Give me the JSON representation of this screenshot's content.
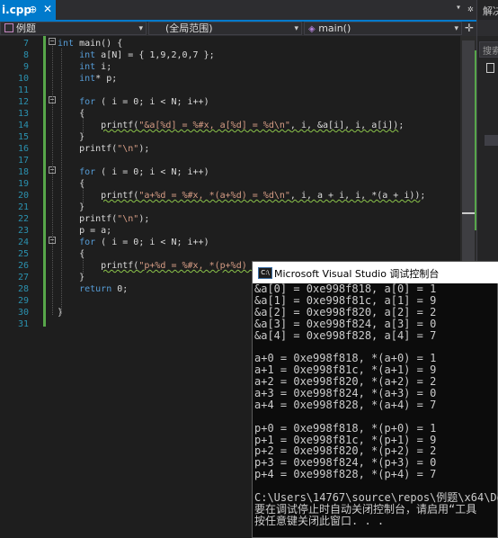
{
  "tab": {
    "filename": "i.cpp",
    "pin": "⊕",
    "close": "✕"
  },
  "toolbar": {
    "dropdown_glyph": "▾",
    "gear_glyph": "✲",
    "split_glyph": "✛"
  },
  "navbar": {
    "project": "例题",
    "scope": "(全局范围)",
    "function": "main()"
  },
  "right_panel": {
    "title": "解决",
    "search": "搜索"
  },
  "editor": {
    "lines": [
      {
        "n": "7",
        "html": "<span class='kw'>int</span> main() {"
      },
      {
        "n": "8",
        "html": "    <span class='kw'>int</span> a[N] = { 1,9,2,0,7 };"
      },
      {
        "n": "9",
        "html": "    <span class='kw'>int</span> i;"
      },
      {
        "n": "10",
        "html": "    <span class='kw'>int</span>* p;"
      },
      {
        "n": "11",
        "html": ""
      },
      {
        "n": "12",
        "html": "    <span class='kw'>for</span> ( i = 0; i &lt; N; i++)"
      },
      {
        "n": "13",
        "html": "    {"
      },
      {
        "n": "14",
        "html": "        <span class='sq'>printf(<span class='str'>\"&amp;a[%d] = %#x, a[%d] = %d\\n\"</span>, i, &amp;a[i], i, a[i])</span>;"
      },
      {
        "n": "15",
        "html": "    }"
      },
      {
        "n": "16",
        "html": "    printf(<span class='str'>\"\\n\"</span>);"
      },
      {
        "n": "17",
        "html": ""
      },
      {
        "n": "18",
        "html": "    <span class='kw'>for</span> ( i = 0; i &lt; N; i++)"
      },
      {
        "n": "19",
        "html": "    {"
      },
      {
        "n": "20",
        "html": "        <span class='sq'>printf(<span class='str'>\"a+%d = %#x, *(a+%d) = %d\\n\"</span>, i, a + i, i, *(a + i))</span>;"
      },
      {
        "n": "21",
        "html": "    }"
      },
      {
        "n": "22",
        "html": "    printf(<span class='str'>\"\\n\"</span>);"
      },
      {
        "n": "23",
        "html": "    p = a;"
      },
      {
        "n": "24",
        "html": "    <span class='kw'>for</span> ( i = 0; i &lt; N; i++)"
      },
      {
        "n": "25",
        "html": "    {"
      },
      {
        "n": "26",
        "html": "        <span class='sq'>printf(<span class='str'>\"p+%d = %#x, *(p+%d) = </span></span>"
      },
      {
        "n": "27",
        "html": "    }"
      },
      {
        "n": "28",
        "html": "    <span class='kw'>return</span> 0;"
      },
      {
        "n": "29",
        "html": ""
      },
      {
        "n": "30",
        "html": "}"
      },
      {
        "n": "31",
        "html": ""
      }
    ]
  },
  "console": {
    "title": "Microsoft Visual Studio 调试控制台",
    "icon_text": "C:\\",
    "lines": [
      "&a[0] = 0xe998f818, a[0] = 1",
      "&a[1] = 0xe998f81c, a[1] = 9",
      "&a[2] = 0xe998f820, a[2] = 2",
      "&a[3] = 0xe998f824, a[3] = 0",
      "&a[4] = 0xe998f828, a[4] = 7",
      "",
      "a+0 = 0xe998f818, *(a+0) = 1",
      "a+1 = 0xe998f81c, *(a+1) = 9",
      "a+2 = 0xe998f820, *(a+2) = 2",
      "a+3 = 0xe998f824, *(a+3) = 0",
      "a+4 = 0xe998f828, *(a+4) = 7",
      "",
      "p+0 = 0xe998f818, *(p+0) = 1",
      "p+1 = 0xe998f81c, *(p+1) = 9",
      "p+2 = 0xe998f820, *(p+2) = 2",
      "p+3 = 0xe998f824, *(p+3) = 0",
      "p+4 = 0xe998f828, *(p+4) = 7",
      "",
      "C:\\Users\\14767\\source\\repos\\例题\\x64\\Debu",
      "要在调试停止时自动关闭控制台，请启用“工具",
      "按任意键关闭此窗口. . ."
    ]
  },
  "colors": {
    "accent": "#007acc",
    "editor_bg": "#1e1e1e",
    "keyword": "#569cd6",
    "string": "#d69d85",
    "line_number": "#2b91af",
    "console_bg": "#0c0c0c"
  }
}
